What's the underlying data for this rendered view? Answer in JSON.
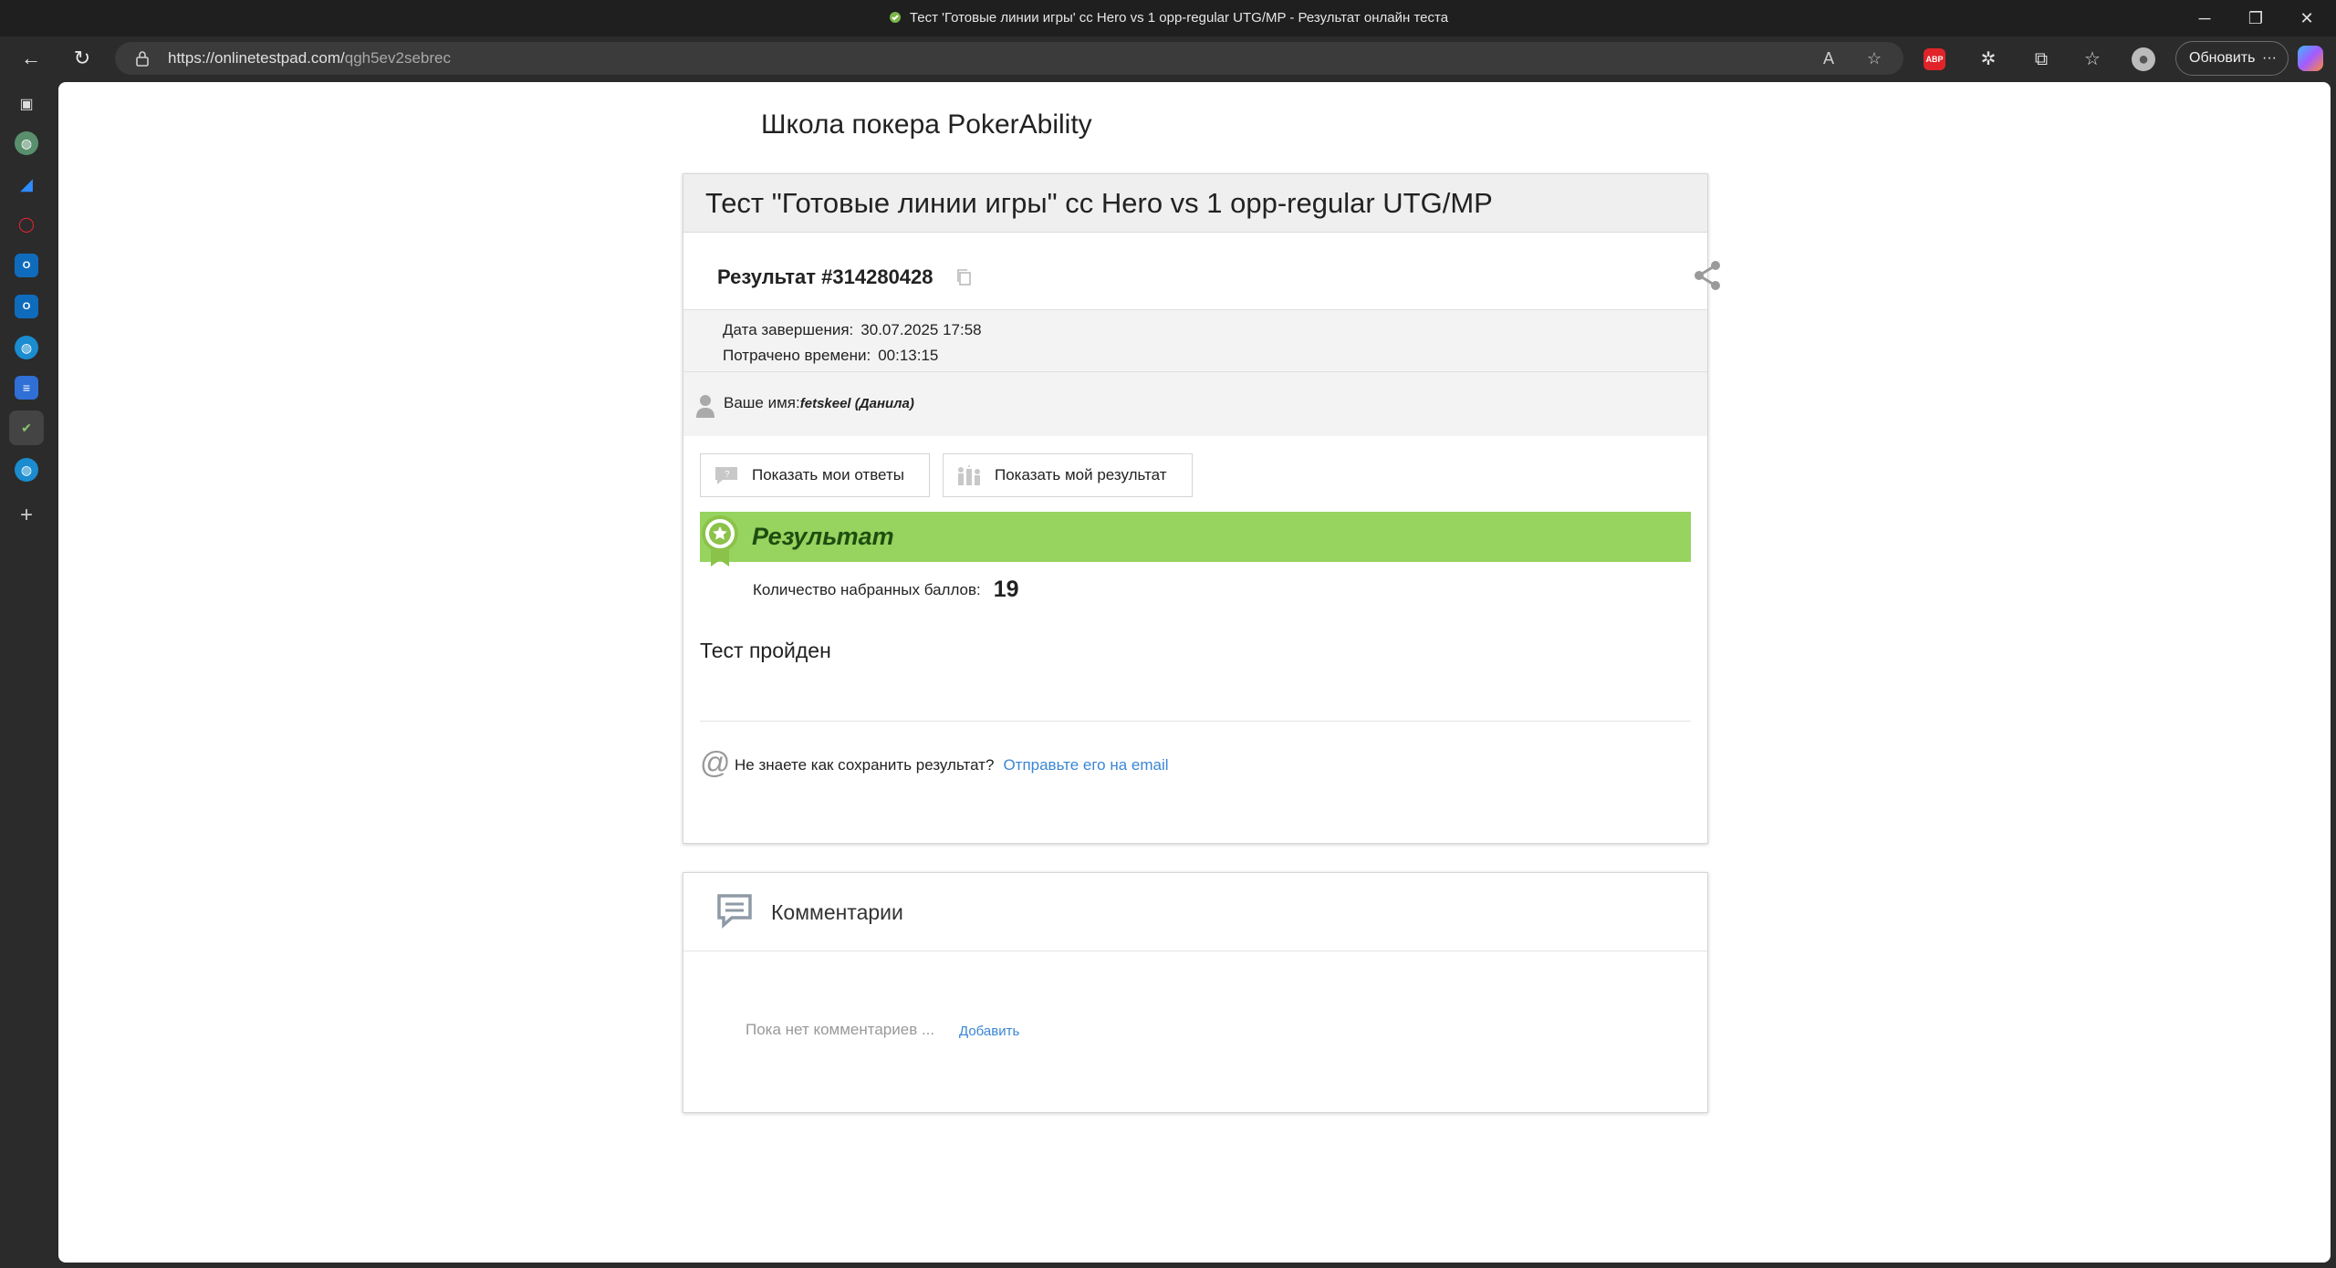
{
  "window": {
    "title": "Тест 'Готовые линии игры' cc Hero vs 1 opp-regular UTG/MP - Результат онлайн теста",
    "minimize": "─",
    "maximize": "❐",
    "close": "✕"
  },
  "browser": {
    "url_host": "https://onlinetestpad.com/",
    "url_path": "qgh5ev2sebrec",
    "update_label": "Обновить",
    "more": "···",
    "ext_badge": "ABP"
  },
  "page": {
    "school": "Школа покера PokerAbility",
    "test_title": "Тест \"Готовые линии игры\" cc Hero vs 1 opp-regular UTG/MP",
    "result_id": "Результат #314280428",
    "completion_label": "Дата завершения:",
    "completion_value": "30.07.2025 17:58",
    "time_label": "Потрачено времени:",
    "time_value": "00:13:15",
    "name_label": "Ваше имя:",
    "name_value": "fetskeel (Данила)",
    "btn_answers": "Показать мои ответы",
    "btn_result": "Показать мой результат",
    "result_heading": "Результат",
    "score_label": "Количество набранных баллов:",
    "score_value": "19",
    "passed": "Тест пройден",
    "email_question": "Не знаете как сохранить результат?",
    "email_link": "Отправьте его на email"
  },
  "comments": {
    "title": "Комментарии",
    "empty": "Пока нет комментариев ...",
    "add": "Добавить"
  },
  "colors": {
    "accent_green": "#97d35f",
    "link_blue": "#3a86d4"
  }
}
